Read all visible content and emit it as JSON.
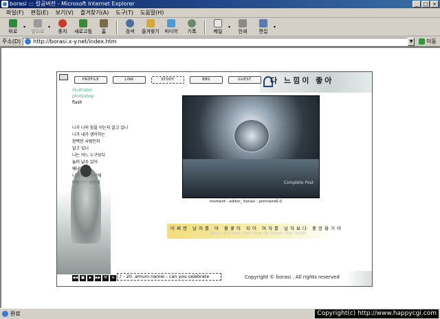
{
  "window": {
    "title": "borasi ::: 칼공버전 - Microsoft Internet Explorer",
    "controls": [
      "_",
      "□",
      "×"
    ]
  },
  "menu": [
    "파일(F)",
    "편집(E)",
    "보기(V)",
    "즐겨찾기(A)",
    "도구(T)",
    "도움말(H)"
  ],
  "toolbar": {
    "back": "뒤로",
    "forward": "앞으로",
    "stop": "중지",
    "refresh": "새로고침",
    "home": "홈",
    "search": "검색",
    "favorites": "즐겨찾기",
    "media": "미디어",
    "history": "기록",
    "mail": "메일",
    "print": "인쇄",
    "edit": "편집"
  },
  "address": {
    "label": "주소(D)",
    "url": "http://borasi.x-y.net/index.htm",
    "go": "이동"
  },
  "site": {
    "nav": [
      "PROFILE",
      "LINK",
      "STUDY",
      "BBS",
      "GUEST"
    ],
    "banner": "다 느낌이 좋아",
    "side_links": [
      "illustrator",
      "photoshop",
      "flash"
    ],
    "poem": [
      "니가 나의 맘을 아는지 알고 있니",
      "니가 내가 생각하는",
      "완벽한 사람인지",
      "알고 있니",
      "나는 어느 누구보다",
      "눌러 날수 있어",
      "왜냐면",
      "니가 니를 믿기에",
      "바람이기 때문에"
    ],
    "screen_caption": "Complete Post",
    "credit": "moment : editor_ borasi : premiere6.0",
    "highlight_ko": "어쩌면 남자를 아 불꽃이 되어 여자를 남자보다 좋았을거야",
    "highlight_en": "you cant see the fake so mask the truth",
    "controls": [
      "◀◀",
      "■",
      "▶",
      "▶▶",
      "M",
      "≡"
    ],
    "track": "♪ - 20. amuro namie - can you celebrate",
    "copyright": "Copyright © borasi . All rights reserved"
  },
  "status": {
    "text": "완료"
  },
  "watermark": "Copyright(c) http://www.happycgi.com"
}
